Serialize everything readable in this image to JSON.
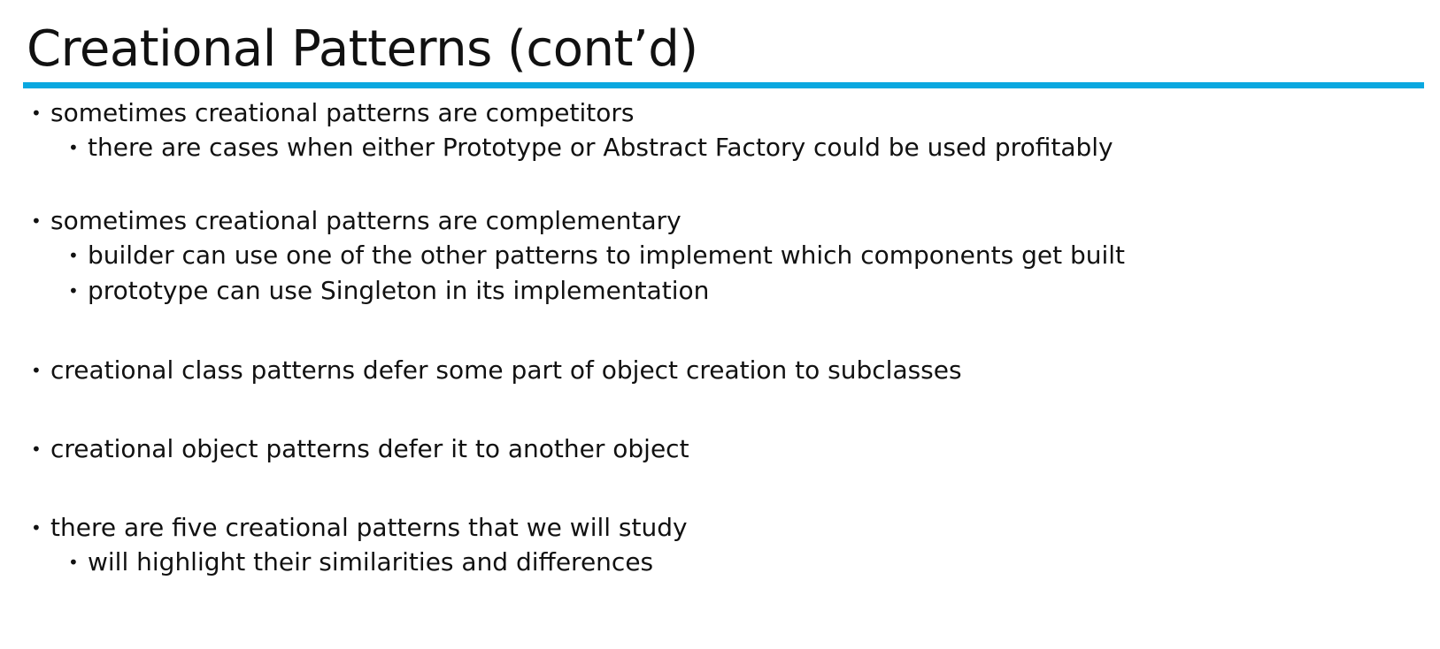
{
  "slide": {
    "title": "Creational Patterns (cont’d)",
    "accent_color": "#0aa8e0",
    "bullet_glyph": "•",
    "groups": [
      {
        "text": "sometimes creational patterns are competitors",
        "subitems": [
          "there are cases when either Prototype or Abstract Factory could be used profitably"
        ]
      },
      {
        "text": "sometimes creational patterns are complementary",
        "subitems": [
          "builder can use one of the other patterns to implement which components get built",
          "prototype can use Singleton in its implementation"
        ]
      },
      {
        "text": "creational class patterns defer some part of object creation to subclasses",
        "subitems": []
      },
      {
        "text": "creational object patterns defer it to another object",
        "subitems": []
      },
      {
        "text": "there are five creational patterns that we will study",
        "subitems": [
          "will highlight their similarities and differences"
        ]
      }
    ]
  }
}
